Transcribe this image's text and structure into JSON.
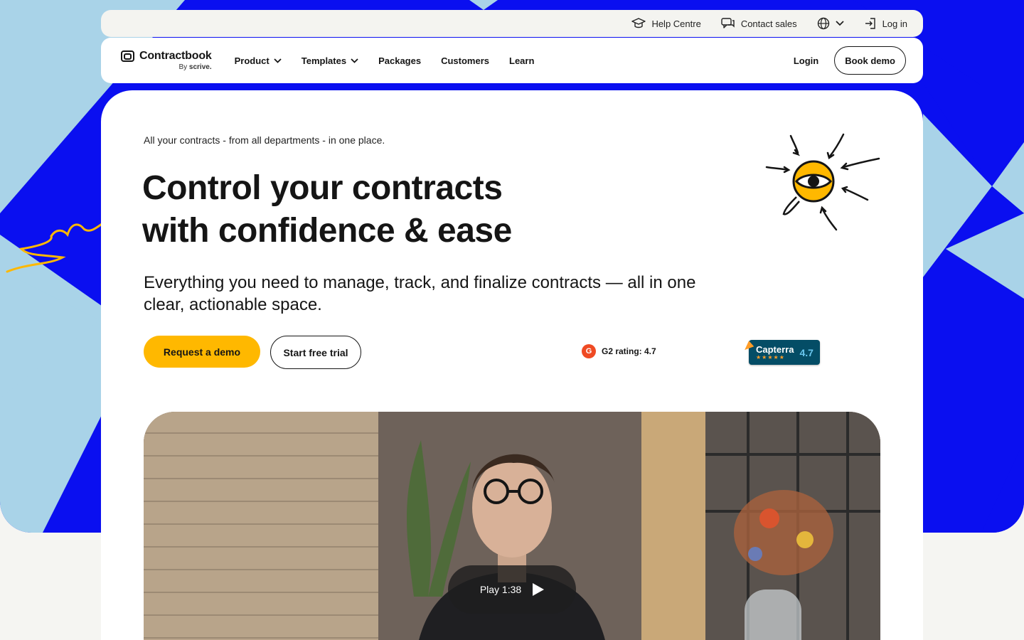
{
  "utility_bar": {
    "help_centre": "Help Centre",
    "contact_sales": "Contact sales",
    "log_in": "Log in"
  },
  "nav": {
    "logo_name": "Contractbook",
    "logo_by": "By",
    "logo_brand": "scrive.",
    "items": [
      "Product",
      "Templates",
      "Packages",
      "Customers",
      "Learn"
    ],
    "login": "Login",
    "book_demo": "Book demo"
  },
  "hero": {
    "eyebrow": "All your contracts - from all departments - in one place.",
    "headline_line1": "Control your contracts",
    "headline_line2": "with confidence & ease",
    "subheadline": "Everything you need to manage, track, and finalize contracts — all in one clear, actionable space.",
    "primary_cta": "Request a demo",
    "secondary_cta": "Start free trial",
    "g2_rating": "G2 rating: 4.7",
    "capterra_name": "Capterra",
    "capterra_score": "4.7",
    "capterra_stars": "★★★★★"
  },
  "video": {
    "play_label": "Play 1:38"
  },
  "colors": {
    "brand_blue": "#0a0ff0",
    "light_blue": "#a9d3e8",
    "primary_yellow": "#ffb800",
    "g2_red": "#ef4a23",
    "capterra_navy": "#044d66"
  },
  "icons": [
    "graduation-cap-icon",
    "chat-bubbles-icon",
    "globe-icon",
    "chevron-down-icon",
    "login-arrow-icon",
    "contractbook-logo-icon",
    "play-icon",
    "g2-logo-icon",
    "capterra-logo-icon",
    "eye-illustration"
  ]
}
